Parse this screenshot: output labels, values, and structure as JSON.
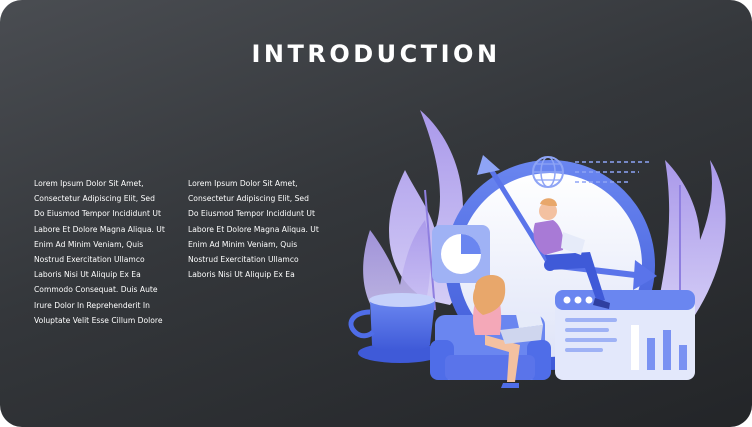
{
  "slide": {
    "title": "INTRODUCTION",
    "columns": [
      {
        "lines": [
          "Lorem Ipsum Dolor Sit Amet,",
          "Consectetur Adipiscing Elit, Sed",
          "Do Eiusmod Tempor Incididunt Ut",
          "Labore Et Dolore Magna Aliqua. Ut",
          "Enim Ad Minim Veniam, Quis",
          "Nostrud Exercitation Ullamco",
          "Laboris Nisi Ut Aliquip Ex Ea",
          "Commodo Consequat. Duis Aute",
          "Irure Dolor In Reprehenderit In",
          "Voluptate Velit Esse Cillum Dolore"
        ]
      },
      {
        "lines": [
          "Lorem Ipsum Dolor Sit Amet,",
          "Consectetur Adipiscing Elit, Sed",
          "Do Eiusmod Tempor Incididunt Ut",
          "Labore Et Dolore Magna Aliqua. Ut",
          "Enim Ad Minim Veniam, Quis",
          "Nostrud Exercitation Ullamco",
          "Laboris Nisi Ut Aliquip Ex Ea"
        ]
      }
    ]
  },
  "illustration": {
    "subject": "clock-with-people-illustration",
    "colors": {
      "background_top": "#4a4d52",
      "background_bottom": "#232528",
      "accent_blue": "#4f6de8",
      "leaf_purple": "#a998ea",
      "text": "#ffffff"
    }
  }
}
